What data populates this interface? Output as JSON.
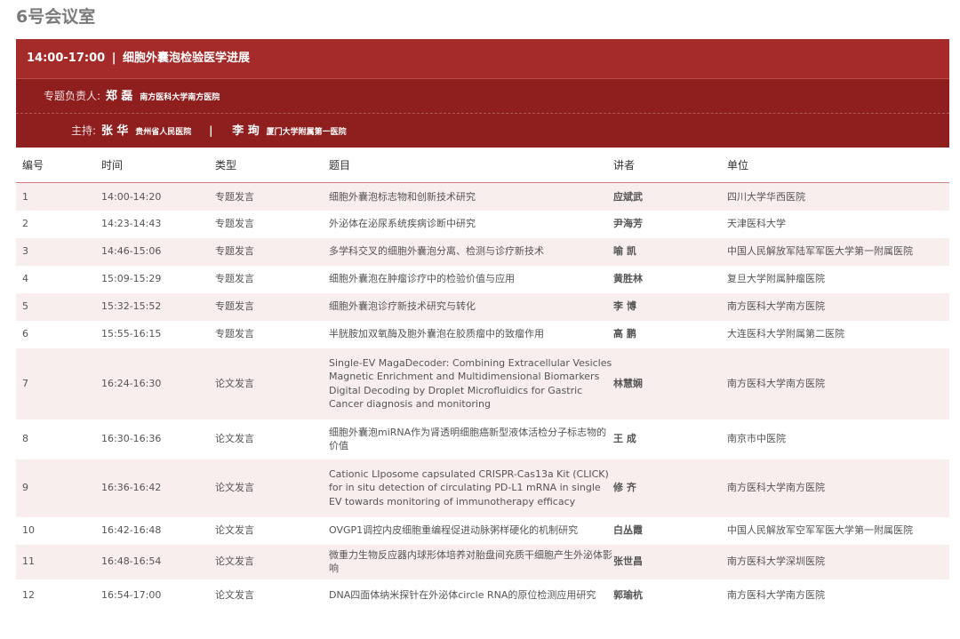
{
  "room": {
    "title": "6号会议室"
  },
  "session": {
    "time": "14:00-17:00",
    "separator": "|",
    "name": "细胞外囊泡检验医学进展",
    "lead": {
      "label": "专题负责人:",
      "name": "郑 磊",
      "institution": "南方医科大学南方医院"
    },
    "host_label": "主持:",
    "hosts": [
      {
        "name": "张 华",
        "institution": "贵州省人民医院"
      },
      {
        "name": "李 珣",
        "institution": "厦门大学附属第一医院"
      }
    ],
    "host_divider": "|"
  },
  "table": {
    "headers": [
      "编号",
      "时间",
      "类型",
      "题目",
      "讲者",
      "单位"
    ],
    "rows": [
      {
        "no": "1",
        "time": "14:00-14:20",
        "type": "专题发言",
        "title": "细胞外囊泡标志物和创新技术研究",
        "speaker": "应斌武",
        "unit": "四川大学华西医院"
      },
      {
        "no": "2",
        "time": "14:23-14:43",
        "type": "专题发言",
        "title": "外泌体在泌尿系统疾病诊断中研究",
        "speaker": "尹海芳",
        "unit": "天津医科大学"
      },
      {
        "no": "3",
        "time": "14:46-15:06",
        "type": "专题发言",
        "title": "多学科交叉的细胞外囊泡分离、检测与诊疗新技术",
        "speaker": "喻 凯",
        "unit": "中国人民解放军陆军军医大学第一附属医院"
      },
      {
        "no": "4",
        "time": "15:09-15:29",
        "type": "专题发言",
        "title": "细胞外囊泡在肿瘤诊疗中的检验价值与应用",
        "speaker": "黄胜林",
        "unit": "复旦大学附属肿瘤医院"
      },
      {
        "no": "5",
        "time": "15:32-15:52",
        "type": "专题发言",
        "title": "细胞外囊泡诊疗新技术研究与转化",
        "speaker": "李 博",
        "unit": "南方医科大学南方医院"
      },
      {
        "no": "6",
        "time": "15:55-16:15",
        "type": "专题发言",
        "title": "半胱胺加双氧酶及胞外囊泡在胶质瘤中的致瘤作用",
        "speaker": "高 鹏",
        "unit": "大连医科大学附属第二医院"
      },
      {
        "no": "7",
        "time": "16:24-16:30",
        "type": "论文发言",
        "title": "Single-EV MagaDecoder: Combining Extracellular Vesicles Magnetic Enrichment and Multidimensional Biomarkers Digital Decoding by Droplet Microfluidics for Gastric Cancer diagnosis and monitoring",
        "speaker": "林慧娴",
        "unit": "南方医科大学南方医院"
      },
      {
        "no": "8",
        "time": "16:30-16:36",
        "type": "论文发言",
        "title": "细胞外囊泡miRNA作为肾透明细胞癌新型液体活检分子标志物的价值",
        "speaker": "王 成",
        "unit": "南京市中医院"
      },
      {
        "no": "9",
        "time": "16:36-16:42",
        "type": "论文发言",
        "title": "Cationic LIposome capsulated CRISPR-Cas13a Kit (CLICK) for in situ detection of circulating PD-L1 mRNA in single EV towards monitoring of immunotherapy efficacy",
        "speaker": "修 齐",
        "unit": "南方医科大学南方医院"
      },
      {
        "no": "10",
        "time": "16:42-16:48",
        "type": "论文发言",
        "title": "OVGP1调控内皮细胞重编程促进动脉粥样硬化的机制研究",
        "speaker": "白丛霞",
        "unit": "中国人民解放军空军军医大学第一附属医院"
      },
      {
        "no": "11",
        "time": "16:48-16:54",
        "type": "论文发言",
        "title": "微重力生物反应器内球形体培养对胎盘间充质干细胞产生外泌体影响",
        "speaker": "张世昌",
        "unit": "南方医科大学深圳医院"
      },
      {
        "no": "12",
        "time": "16:54-17:00",
        "type": "论文发言",
        "title": "DNA四面体纳米探针在外泌体circle RNA的原位检测应用研究",
        "speaker": "郭瑜杭",
        "unit": "南方医科大学南方医院"
      }
    ]
  },
  "colors": {
    "header_bar": "#a52a2a",
    "sub_bar": "#8f1f1f",
    "row_alt": "#f9eeee"
  }
}
